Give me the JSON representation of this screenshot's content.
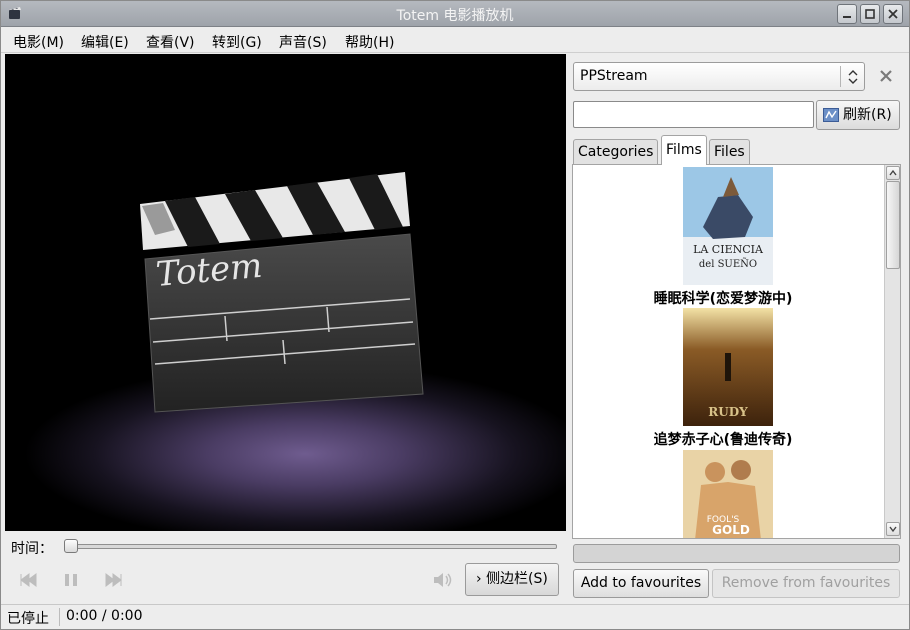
{
  "window": {
    "title": "Totem 电影播放机"
  },
  "menu": {
    "items": [
      {
        "label": "电影(M)"
      },
      {
        "label": "编辑(E)"
      },
      {
        "label": "查看(V)"
      },
      {
        "label": "转到(G)"
      },
      {
        "label": "声音(S)"
      },
      {
        "label": "帮助(H)"
      }
    ]
  },
  "video": {
    "logo_text": "Totem"
  },
  "controls": {
    "time_label": "时间：",
    "seek_position": 0,
    "sidebar_button": "侧边栏(S)"
  },
  "status": {
    "state": "已停止",
    "time": "0:00 / 0:00"
  },
  "sidebar": {
    "plugin_selected": "PPStream",
    "search_value": "",
    "refresh_label": "刷新(R)",
    "tabs": [
      {
        "label": "Categories",
        "active": false
      },
      {
        "label": "Films",
        "active": true
      },
      {
        "label": "Files",
        "active": false
      }
    ],
    "films": [
      {
        "title": "睡眠科学(恋爱梦游中)",
        "poster_text": [
          "LA CIENCIA",
          "del SUEÑO"
        ]
      },
      {
        "title": "追梦赤子心(鲁迪传奇)",
        "poster_text": [
          "RUDY"
        ]
      },
      {
        "title": "",
        "poster_text": [
          "FOOL'S",
          "GOLD"
        ]
      }
    ],
    "progress": 0,
    "add_favourites": "Add to favourites",
    "remove_favourites": "Remove from favourites"
  },
  "colors": {
    "titlebar": "#a5aab0",
    "accent": "#6b8fc7",
    "video_bg": "#000000"
  },
  "icons": [
    "app-icon",
    "minimize-icon",
    "maximize-icon",
    "close-icon",
    "skip-back-icon",
    "pause-icon",
    "skip-forward-icon",
    "volume-icon",
    "chevron-right-icon",
    "refresh-icon",
    "combo-arrows-icon",
    "close-sidebar-icon"
  ]
}
